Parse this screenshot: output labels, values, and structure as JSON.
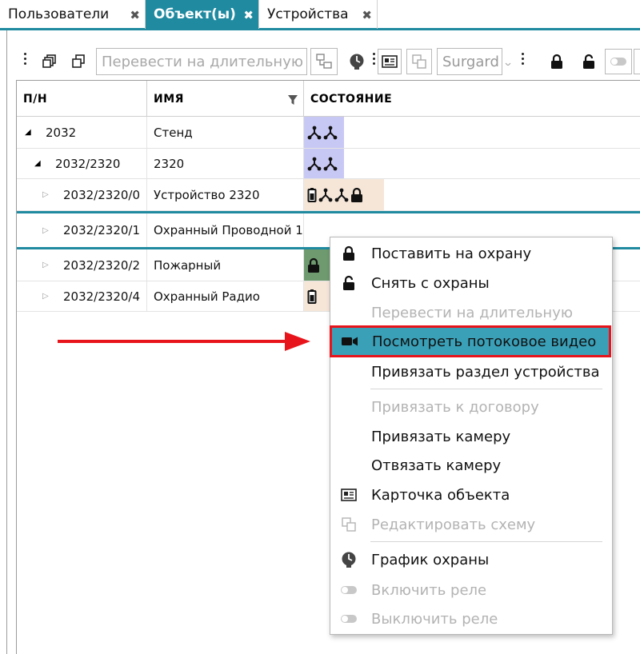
{
  "tabs": [
    {
      "label": "Пользователи",
      "close": "✖"
    },
    {
      "label": "Объект(ы)",
      "close": "✖"
    },
    {
      "label": "Устройства",
      "close": "✖"
    }
  ],
  "toolbar": {
    "mode_input": "Перевести на длительную",
    "protocol_input": "Surgard"
  },
  "grid": {
    "headers": [
      "П/Н",
      "ИМЯ",
      "СОСТОЯНИЕ"
    ],
    "rows": [
      {
        "pn": "2032",
        "name": "Стенд"
      },
      {
        "pn": "2032/2320",
        "name": "2320"
      },
      {
        "pn": "2032/2320/0",
        "name": "Устройство 2320"
      },
      {
        "pn": "2032/2320/1",
        "name": "Охранный Проводной 1"
      },
      {
        "pn": "2032/2320/2",
        "name": "Пожарный"
      },
      {
        "pn": "2032/2320/4",
        "name": "Охранный Радио"
      }
    ]
  },
  "context_menu": {
    "items": [
      {
        "label": "Поставить на охрану",
        "icon": "lock-icon",
        "enabled": true
      },
      {
        "label": "Снять с охраны",
        "icon": "unlock-icon",
        "enabled": true
      },
      {
        "label": "Перевести на длительную",
        "icon": "",
        "enabled": false
      },
      {
        "label": "Посмотреть потоковое видео",
        "icon": "video-camera-icon",
        "enabled": true,
        "highlighted": true
      },
      {
        "label": "Привязать раздел устройства",
        "icon": "",
        "enabled": true
      },
      {
        "label": "Привязать к договору",
        "icon": "",
        "enabled": false
      },
      {
        "label": "Привязать камеру",
        "icon": "",
        "enabled": true
      },
      {
        "label": "Отвязать камеру",
        "icon": "",
        "enabled": true
      },
      {
        "label": "Карточка объекта",
        "icon": "id-card-icon",
        "enabled": true
      },
      {
        "label": "Редактировать схему",
        "icon": "edit-scheme-icon",
        "enabled": false
      },
      {
        "label": "График охраны",
        "icon": "schedule-clock-icon",
        "enabled": true
      },
      {
        "label": "Включить реле",
        "icon": "toggle-icon",
        "enabled": false
      },
      {
        "label": "Выключить реле",
        "icon": "toggle-icon",
        "enabled": false
      }
    ]
  },
  "colors": {
    "accent": "#1f8aa0",
    "highlight_bg": "#3aa0b8",
    "highlight_border": "#e8141b",
    "status_blue": "#c8c8f5",
    "status_beige": "#f5e6d8",
    "status_green": "#6f9a6f"
  }
}
